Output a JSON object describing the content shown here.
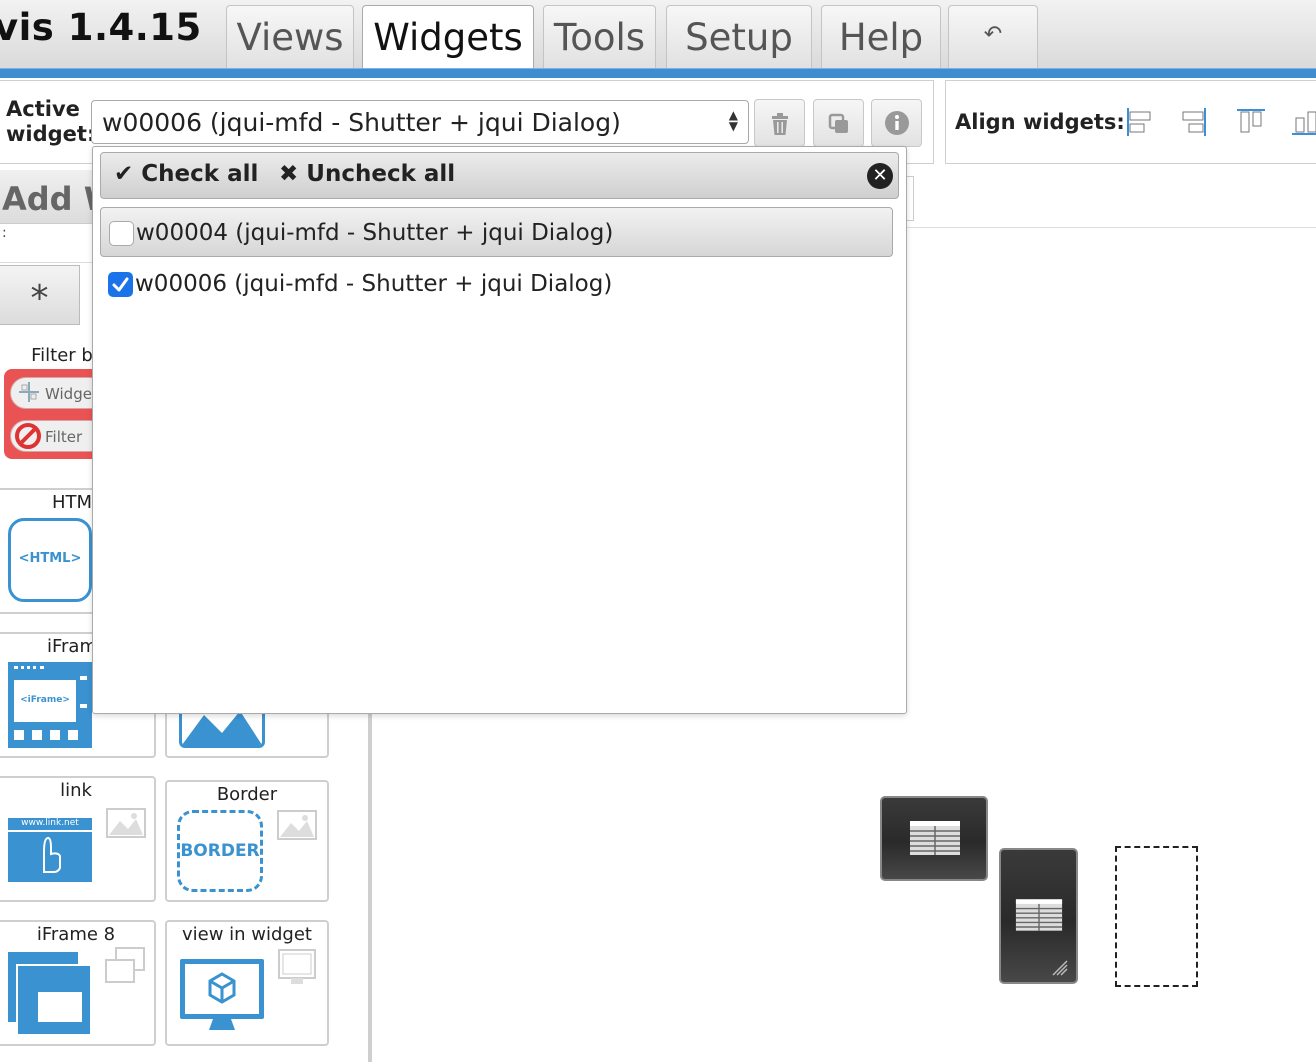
{
  "app": {
    "title": "vis 1.4.15"
  },
  "menu": {
    "tabs": [
      {
        "label": "Views"
      },
      {
        "label": "Widgets"
      },
      {
        "label": "Tools"
      },
      {
        "label": "Setup"
      },
      {
        "label": "Help"
      }
    ],
    "active_tab": "Widgets"
  },
  "toolbar": {
    "active_widget_label_line1": "Active",
    "active_widget_label_line2": "widget:",
    "active_widget_value": "w00006 (jqui-mfd - Shutter + jqui Dialog)",
    "align_label": "Align widgets:"
  },
  "dropdown": {
    "check_all": "Check all",
    "uncheck_all": "Uncheck all",
    "options": [
      {
        "label": "w00004 (jqui-mfd - Shutter + jqui Dialog)",
        "checked": false
      },
      {
        "label": "w00006 (jqui-mfd - Shutter + jqui Dialog)",
        "checked": true
      }
    ]
  },
  "palette": {
    "header": "Add W",
    "star": "*",
    "filter_label": "Filter b",
    "filter_pills": [
      {
        "label": "Widget"
      },
      {
        "label": "Filter"
      }
    ],
    "cards": [
      {
        "name": "HTM",
        "icon_text": "<HTML>"
      },
      {
        "name": "iFram",
        "icon_text": "<iFrame>"
      },
      {
        "name": "link",
        "icon_text": "www.link.net"
      },
      {
        "name": "Border",
        "icon_text": "BORDER"
      },
      {
        "name": "iFrame 8"
      },
      {
        "name": "view in widget"
      }
    ]
  },
  "colors": {
    "accent_blue": "#3d8dd0",
    "icon_blue": "#3a92d0",
    "filter_red": "#e95353",
    "checkbox_blue": "#1a73e8"
  }
}
